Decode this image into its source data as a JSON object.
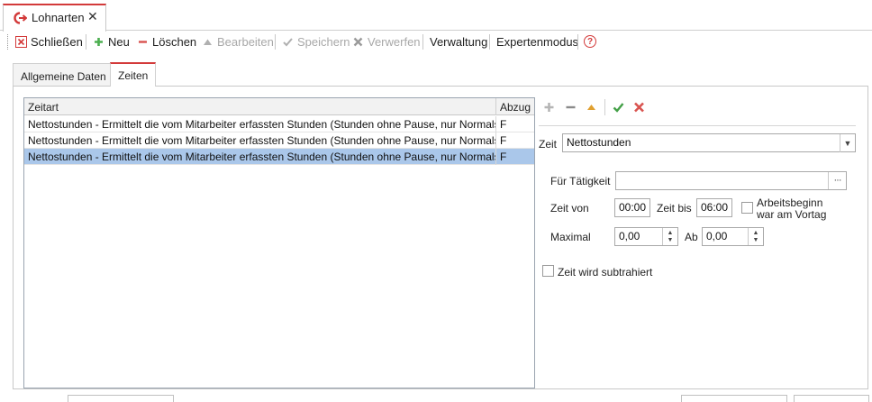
{
  "document_tab": {
    "title": "Lohnarten",
    "close": "✕"
  },
  "toolbar": {
    "close_label": "Schließen",
    "new_label": "Neu",
    "delete_label": "Löschen",
    "edit_label": "Bearbeiten",
    "save_label": "Speichern",
    "discard_label": "Verwerfen",
    "manage_label": "Verwaltung",
    "expert_label": "Expertenmodus",
    "help_icon": "?"
  },
  "tabs": [
    {
      "label": "Allgemeine Daten",
      "active": false
    },
    {
      "label": "Zeiten",
      "active": true
    }
  ],
  "grid": {
    "columns": [
      "Zeitart",
      "Abzug"
    ],
    "rows": [
      {
        "zeitart": "Nettostunden - Ermittelt die vom Mitarbeiter erfassten Stunden (Stunden ohne Pause, nur Normalstu",
        "abzug": "F",
        "selected": false
      },
      {
        "zeitart": "Nettostunden - Ermittelt die vom Mitarbeiter erfassten Stunden (Stunden ohne Pause, nur Normalstu",
        "abzug": "F",
        "selected": false
      },
      {
        "zeitart": "Nettostunden - Ermittelt die vom Mitarbeiter erfassten Stunden (Stunden ohne Pause, nur Normalstu",
        "abzug": "F",
        "selected": true
      }
    ]
  },
  "detail": {
    "zeit_label": "Zeit",
    "zeit_value": "Nettostunden",
    "taetigkeit_label": "Für Tätigkeit",
    "taetigkeit_value": "",
    "ellipsis": "···",
    "zeit_von_label": "Zeit von",
    "zeit_von_value": "00:00",
    "zeit_bis_label": "Zeit bis",
    "zeit_bis_value": "06:00",
    "arbeitsbeginn_label_1": "Arbeitsbeginn",
    "arbeitsbeginn_label_2": "war am Vortag",
    "maximal_label": "Maximal",
    "maximal_value": "0,00",
    "ab_label": "Ab",
    "ab_value": "0,00",
    "subtrahiert_label": "Zeit wird subtrahiert"
  },
  "colors": {
    "accent": "#d33a3a",
    "selection": "#aac7ea",
    "add": "#4caf50",
    "check": "#43a047"
  }
}
